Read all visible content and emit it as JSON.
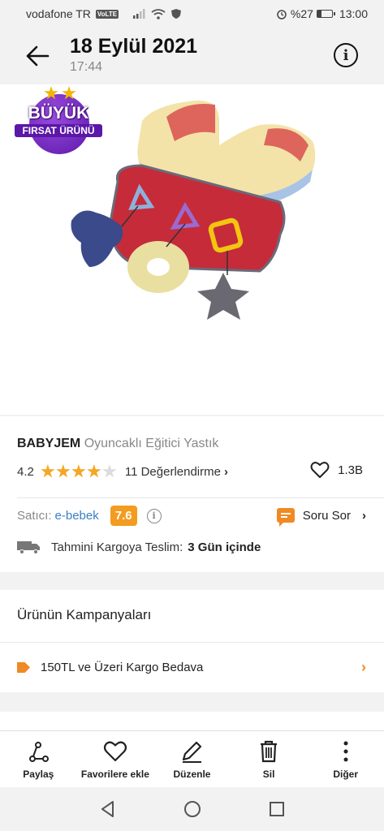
{
  "status_bar": {
    "carrier": "vodafone TR",
    "volte": "VoLTE",
    "battery": "%27",
    "battery_level": 0.27,
    "time": "13:00"
  },
  "header": {
    "title": "18 Eylül 2021",
    "subtitle": "17:44"
  },
  "badge": {
    "line1": "BÜYÜK",
    "line2": "FIRSAT ÜRÜNÜ"
  },
  "product": {
    "brand": "BABYJEM",
    "name": "Oyuncaklı Eğitici Yastık",
    "rating": "4.2",
    "rating_value": 4.2,
    "rating_max": 5,
    "reviews": "11 Değerlendirme",
    "favorites": "1.3B"
  },
  "seller": {
    "label": "Satıcı:",
    "name": "e-bebek",
    "score": "7.6",
    "ask_label": "Soru Sor"
  },
  "shipping": {
    "label": "Tahmini Kargoya Teslim:",
    "value": "3 Gün içinde"
  },
  "campaigns": {
    "title": "Ürünün Kampanyaları",
    "items": [
      {
        "label": "150TL ve Üzeri Kargo Bedava"
      }
    ]
  },
  "actions": [
    {
      "label": "Paylaş",
      "icon": "share-icon"
    },
    {
      "label": "Favorilere ekle",
      "icon": "heart-icon"
    },
    {
      "label": "Düzenle",
      "icon": "pencil-icon"
    },
    {
      "label": "Sil",
      "icon": "trash-icon"
    },
    {
      "label": "Diğer",
      "icon": "more-icon"
    }
  ],
  "colors": {
    "accent": "#f08a24",
    "star": "#f5a623",
    "link": "#3b7fc4",
    "score_badge": "#f39c1f",
    "badge_purple": "#5b17a8"
  }
}
